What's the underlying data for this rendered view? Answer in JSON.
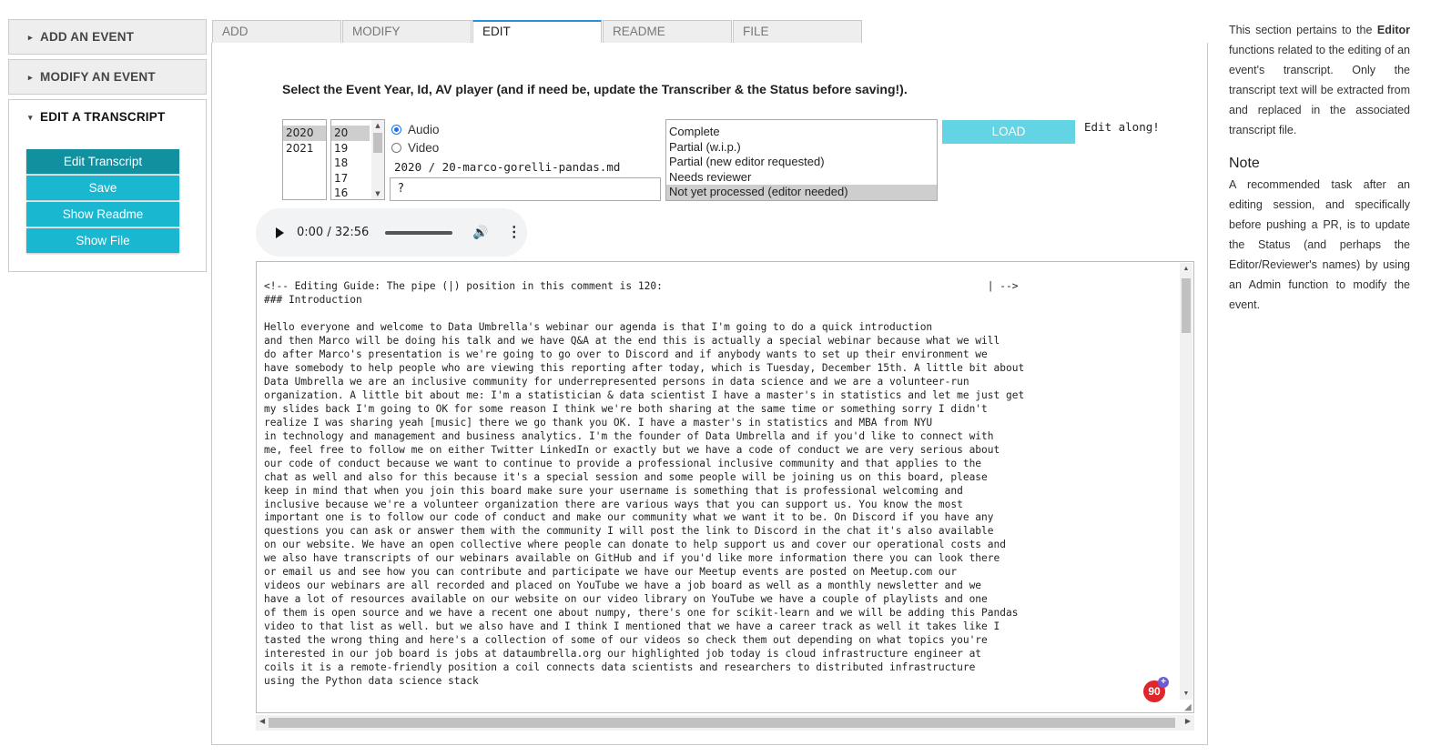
{
  "sidebar": {
    "add_event": "ADD AN EVENT",
    "modify_event": "MODIFY AN EVENT",
    "edit_transcript": "EDIT A TRANSCRIPT",
    "buttons": [
      "Edit Transcript",
      "Save",
      "Show Readme",
      "Show File"
    ]
  },
  "tabs": [
    "ADD",
    "MODIFY",
    "EDIT",
    "README",
    "FILE"
  ],
  "instruction": "Select the Event Year, Id, AV player (and if need be, update the Transcriber & the Status before saving!).",
  "years": [
    "2020",
    "2021"
  ],
  "ids": [
    "20",
    "19",
    "18",
    "17",
    "16"
  ],
  "player": {
    "audio": "Audio",
    "video": "Video"
  },
  "file_path": "2020 / 20-marco-gorelli-pandas.md",
  "transcriber_value": "?",
  "statuses": [
    "Complete",
    "Partial (w.i.p.)",
    "Partial (new editor requested)",
    "Needs reviewer",
    "Not yet processed (editor needed)"
  ],
  "load_label": "LOAD",
  "edit_along": "Edit along!",
  "audio": {
    "time": "0:00 / 32:56"
  },
  "transcript_lines": [
    "<!-- Editing Guide: The pipe (|) position in this comment is 120:                                                     | -->",
    "### Introduction",
    "",
    "Hello everyone and welcome to Data Umbrella's webinar our agenda is that I'm going to do a quick introduction",
    "and then Marco will be doing his talk and we have Q&A at the end this is actually a special webinar because what we will",
    "do after Marco's presentation is we're going to go over to Discord and if anybody wants to set up their environment we",
    "have somebody to help people who are viewing this reporting after today, which is Tuesday, December 15th. A little bit about",
    "Data Umbrella we are an inclusive community for underrepresented persons in data science and we are a volunteer-run",
    "organization. A little bit about me: I'm a statistician & data scientist I have a master's in statistics and let me just get",
    "my slides back I'm going to OK for some reason I think we're both sharing at the same time or something sorry I didn't",
    "realize I was sharing yeah [music] there we go thank you OK. I have a master's in statistics and MBA from NYU",
    "in technology and management and business analytics. I'm the founder of Data Umbrella and if you'd like to connect with",
    "me, feel free to follow me on either Twitter LinkedIn or exactly but we have a code of conduct we are very serious about",
    "our code of conduct because we want to continue to provide a professional inclusive community and that applies to the",
    "chat as well and also for this because it's a special session and some people will be joining us on this board, please",
    "keep in mind that when you join this board make sure your username is something that is professional welcoming and",
    "inclusive because we're a volunteer organization there are various ways that you can support us. You know the most",
    "important one is to follow our code of conduct and make our community what we want it to be. On Discord if you have any",
    "questions you can ask or answer them with the community I will post the link to Discord in the chat it's also available",
    "on our website. We have an open collective where people can donate to help support us and cover our operational costs and",
    "we also have transcripts of our webinars available on GitHub and if you'd like more information there you can look there",
    "or email us and see how you can contribute and participate we have our Meetup events are posted on Meetup.com our",
    "videos our webinars are all recorded and placed on YouTube we have a job board as well as a monthly newsletter and we",
    "have a lot of resources available on our website on our video library on YouTube we have a couple of playlists and one",
    "of them is open source and we have a recent one about numpy, there's one for scikit-learn and we will be adding this Pandas",
    "video to that list as well. but we also have and I think I mentioned that we have a career track as well it takes like I",
    "tasted the wrong thing and here's a collection of some of our videos so check them out depending on what topics you're",
    "interested in our job board is jobs at dataumbrella.org our highlighted job today is cloud infrastructure engineer at",
    "coils it is a remote-friendly position a coil connects data scientists and researchers to distributed infrastructure",
    "using the Python data science stack"
  ],
  "badge": "90",
  "side": {
    "intro_prefix": "This section pertains to the ",
    "intro_bold": "Editor",
    "intro_suffix": " functions related to the editing of an event's transcript. Only the transcript text will be extracted from and replaced in the associated transcript file.",
    "note_title": "Note",
    "note_text": "A recommended task after an editing session, and specifically before pushing a PR, is to update the Status (and perhaps the Editor/Reviewer's names) by using an Admin function to modify the event."
  }
}
